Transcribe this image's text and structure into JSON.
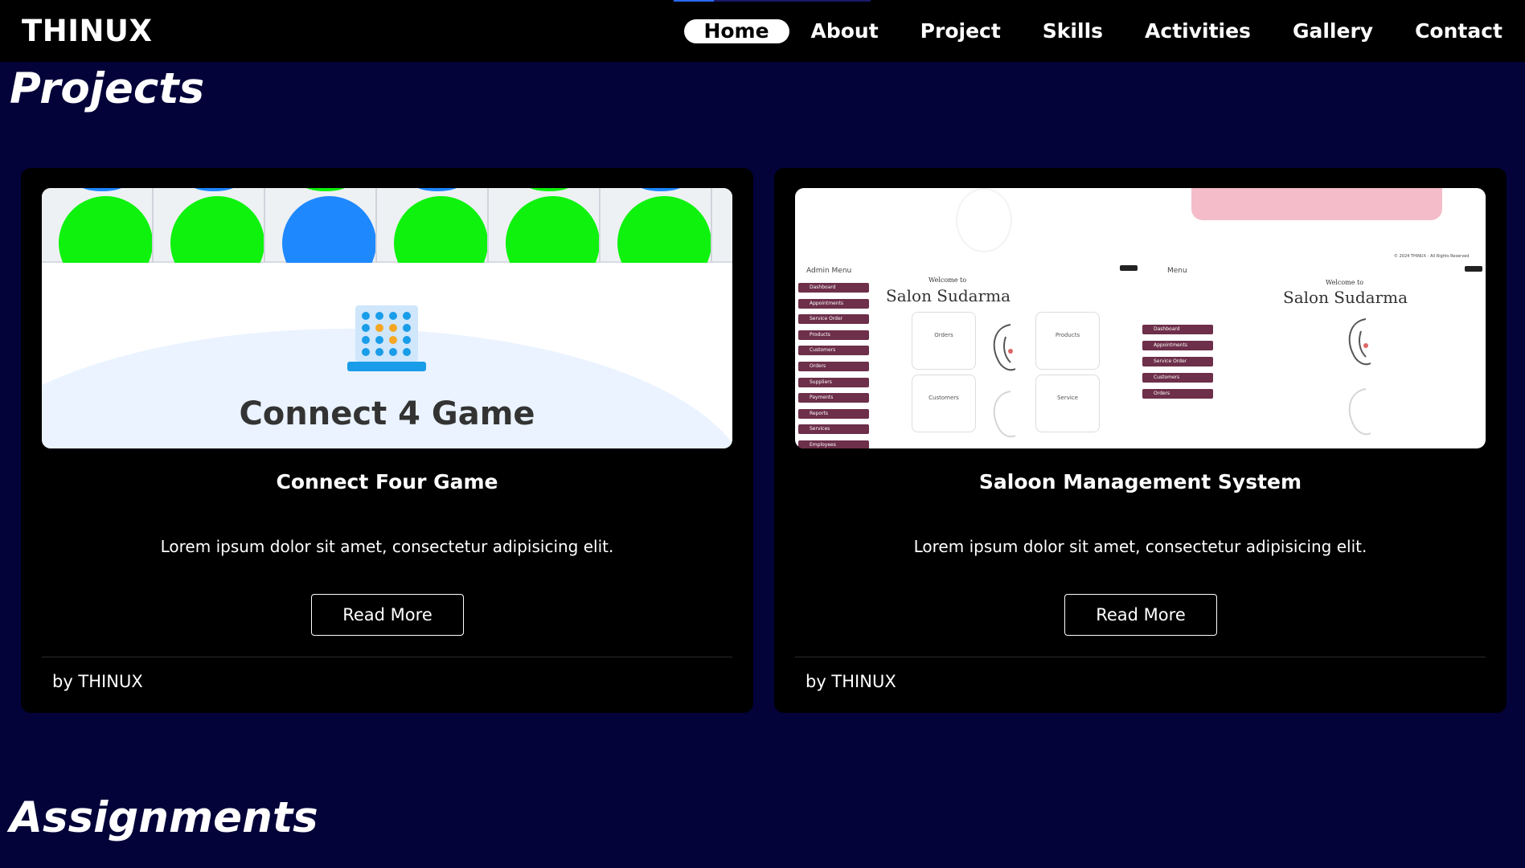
{
  "nav": {
    "logo": "THINUX",
    "links": [
      "Home",
      "About",
      "Project",
      "Skills",
      "Activities",
      "Gallery",
      "Contact"
    ],
    "active": "Home"
  },
  "sections": {
    "projects_title": "Projects",
    "assignments_title": "Assignments"
  },
  "projects": [
    {
      "title": "Connect Four Game",
      "description": "Lorem ipsum dolor sit amet, consectetur adipisicing elit.",
      "button": "Read More",
      "footer": "by THINUX",
      "thumbnail": {
        "caption": "Connect 4 Game",
        "disc_colors": [
          "#0ef20e",
          "#0ef20e",
          "#1e88ff",
          "#0ef20e",
          "#0ef20e",
          "#0ef20e"
        ],
        "top_disc_colors": [
          "#1e88ff",
          "#1e88ff",
          "#0ef20e",
          "#1e88ff",
          "#0ef20e",
          "#1e88ff"
        ]
      }
    },
    {
      "title": "Saloon Management System",
      "description": "Lorem ipsum dolor sit amet, consectetur adipisicing elit.",
      "button": "Read More",
      "footer": "by THINUX",
      "thumbnail": {
        "admin_menu_label": "Admin Menu",
        "menu_label": "Menu",
        "welcome": "Welcome to",
        "salon_name": "Salon Sudarma",
        "copyright": "© 2024 THINUX - All Rights Reserved",
        "admin_items": [
          "Dashboard",
          "Appointments",
          "Service Order",
          "Products",
          "Customers",
          "Orders",
          "Suppliers",
          "Payments",
          "Reports",
          "Services",
          "Employees"
        ],
        "menu_items": [
          "Dashboard",
          "Appointments",
          "Service Order",
          "Customers",
          "Orders"
        ],
        "stat_boxes": [
          "Orders",
          "Products",
          "Customers",
          "Service"
        ]
      }
    }
  ],
  "colors": {
    "page_bg": "#03033a",
    "nav_bg": "#000000",
    "card_bg": "#000000",
    "salon_menu": "#6d2f4a",
    "salon_pink": "#f4bcc9"
  }
}
